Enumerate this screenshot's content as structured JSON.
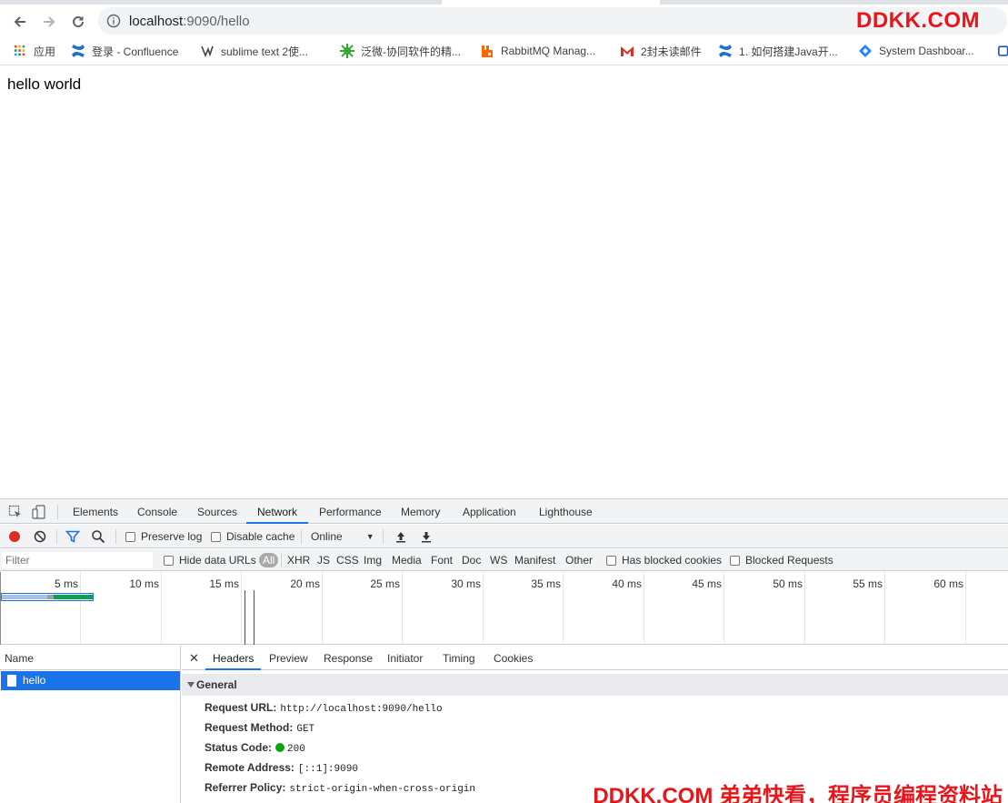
{
  "browser": {
    "url_host": "localhost",
    "url_path": ":9090/hello",
    "watermark_top": "DDKK.COM"
  },
  "bookmarks": [
    {
      "label": "应用",
      "icon": "apps-grid-icon"
    },
    {
      "label": "登录 - Confluence",
      "icon": "confluence-icon"
    },
    {
      "label": "sublime text 2使...",
      "icon": "sublime-icon"
    },
    {
      "label": "泛微-协同软件的精...",
      "icon": "weaver-icon"
    },
    {
      "label": "RabbitMQ Manag...",
      "icon": "rabbitmq-icon"
    },
    {
      "label": "2封未读邮件",
      "icon": "mail-icon"
    },
    {
      "label": "1. 如何搭建Java开...",
      "icon": "confluence-icon"
    },
    {
      "label": "System Dashboar...",
      "icon": "jira-icon"
    }
  ],
  "page": {
    "body_text": "hello world"
  },
  "devtools": {
    "tabs": [
      "Elements",
      "Console",
      "Sources",
      "Network",
      "Performance",
      "Memory",
      "Application",
      "Lighthouse"
    ],
    "active_tab": "Network",
    "toolbar": {
      "preserve_log": "Preserve log",
      "disable_cache": "Disable cache",
      "throttle": "Online"
    },
    "filter": {
      "placeholder": "Filter",
      "hide_data_urls": "Hide data URLs",
      "types": [
        "All",
        "XHR",
        "JS",
        "CSS",
        "Img",
        "Media",
        "Font",
        "Doc",
        "WS",
        "Manifest",
        "Other"
      ],
      "has_blocked_cookies": "Has blocked cookies",
      "blocked_requests": "Blocked Requests"
    },
    "timeline_labels": [
      "5 ms",
      "10 ms",
      "15 ms",
      "20 ms",
      "25 ms",
      "30 ms",
      "35 ms",
      "40 ms",
      "45 ms",
      "50 ms",
      "55 ms",
      "60 ms"
    ],
    "request_list": {
      "column": "Name",
      "rows": [
        "hello"
      ]
    },
    "detail_tabs": [
      "Headers",
      "Preview",
      "Response",
      "Initiator",
      "Timing",
      "Cookies"
    ],
    "active_detail_tab": "Headers",
    "general": {
      "title": "General",
      "request_url_label": "Request URL:",
      "request_url": "http://localhost:9090/hello",
      "request_method_label": "Request Method:",
      "request_method": "GET",
      "status_code_label": "Status Code:",
      "status_code": "200",
      "remote_address_label": "Remote Address:",
      "remote_address": "[::1]:9090",
      "referrer_policy_label": "Referrer Policy:",
      "referrer_policy": "strict-origin-when-cross-origin"
    }
  },
  "watermark_bottom": "DDKK.COM 弟弟快看，程序员编程资料站"
}
